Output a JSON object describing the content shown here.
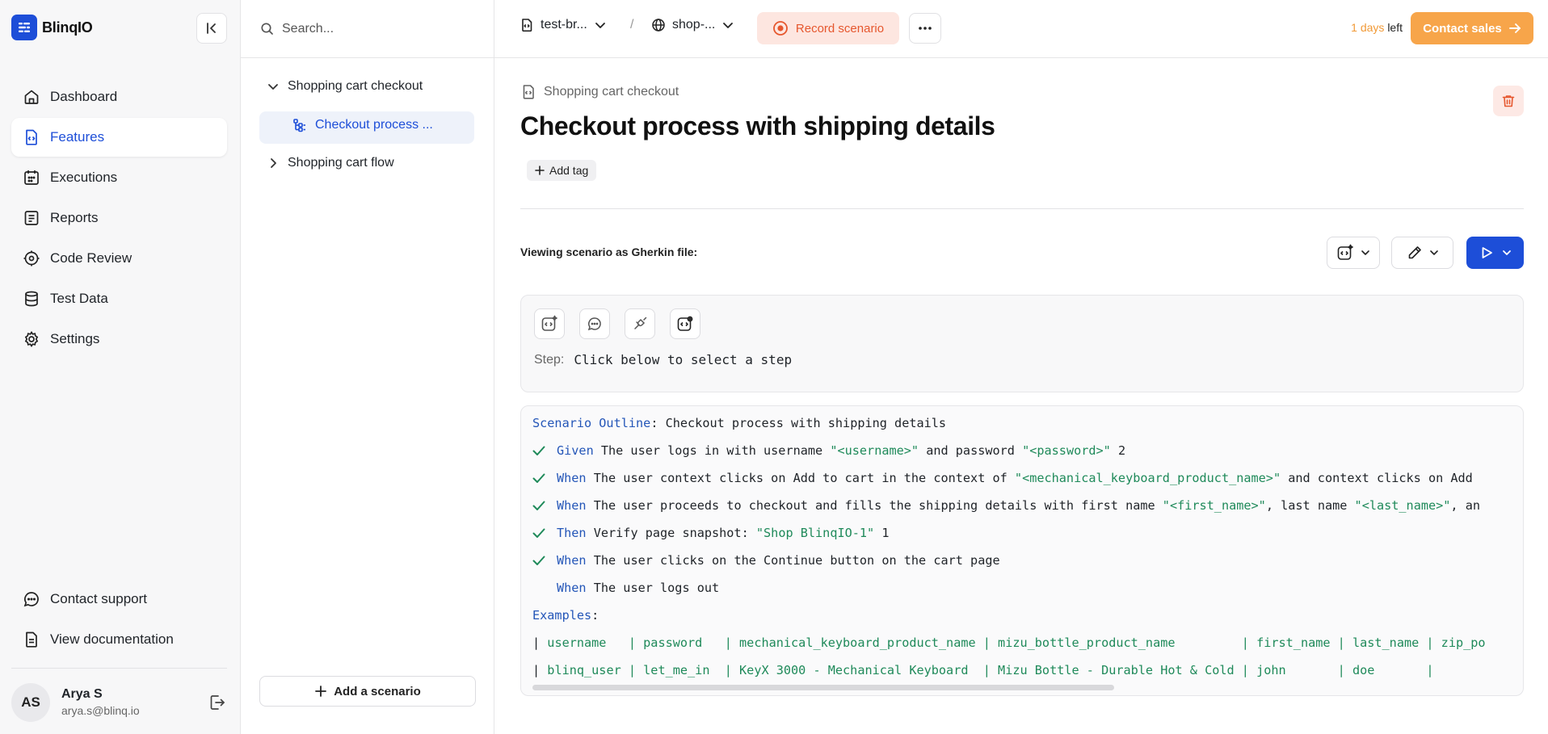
{
  "app": {
    "name": "BlinqIO"
  },
  "sidebar": {
    "collapse_label": "Collapse sidebar",
    "nav": [
      {
        "label": "Dashboard",
        "icon": "home-icon"
      },
      {
        "label": "Features",
        "icon": "feature-file-icon",
        "active": true
      },
      {
        "label": "Executions",
        "icon": "calendar-icon"
      },
      {
        "label": "Reports",
        "icon": "report-icon"
      },
      {
        "label": "Code Review",
        "icon": "code-review-icon"
      },
      {
        "label": "Test Data",
        "icon": "database-icon"
      },
      {
        "label": "Settings",
        "icon": "gear-icon"
      }
    ],
    "bottom": [
      {
        "label": "Contact support",
        "icon": "chat-icon"
      },
      {
        "label": "View documentation",
        "icon": "document-icon"
      }
    ],
    "user": {
      "initials": "AS",
      "name": "Arya S",
      "email": "arya.s@blinq.io"
    }
  },
  "tree": {
    "search_placeholder": "Search...",
    "items": [
      {
        "label": "Shopping cart checkout",
        "expanded": true
      },
      {
        "label": "Checkout process ...",
        "selected": true
      },
      {
        "label": "Shopping cart flow",
        "expanded": false
      }
    ],
    "add_scenario_label": "Add a scenario"
  },
  "topbar": {
    "project": "test-br...",
    "separator": "/",
    "environment": "shop-...",
    "record_label": "Record scenario",
    "trial_days": "1 days",
    "trial_suffix": "left",
    "contact_sales_label": "Contact sales"
  },
  "main": {
    "feature_name": "Shopping cart checkout",
    "title": "Checkout process with shipping details",
    "add_tag_label": "Add tag",
    "viewing_label": "Viewing scenario as Gherkin file:",
    "step_label": "Step:",
    "step_value": "Click below to select a step",
    "colors": {
      "accent": "#1d4ed8",
      "record": "#e6572e",
      "sales": "#f7a54a",
      "keyword": "#2456b8",
      "string": "#1f8a5a"
    }
  },
  "gherkin": {
    "outline_keyword": "Scenario Outline",
    "outline_title": ": Checkout process with shipping details",
    "steps": [
      {
        "done": true,
        "keyword": "Given",
        "parts": [
          {
            "t": " The user logs in with username "
          },
          {
            "s": "\"<username>\""
          },
          {
            "t": " and password "
          },
          {
            "s": "\"<password>\""
          },
          {
            "t": " 2"
          }
        ]
      },
      {
        "done": true,
        "keyword": "When",
        "parts": [
          {
            "t": " The user context clicks on Add to cart in the context of "
          },
          {
            "s": "\"<mechanical_keyboard_product_name>\""
          },
          {
            "t": " and context clicks on Add"
          }
        ]
      },
      {
        "done": true,
        "keyword": "When",
        "parts": [
          {
            "t": " The user proceeds to checkout and fills the shipping details with first name "
          },
          {
            "s": "\"<first_name>\""
          },
          {
            "t": ", last name "
          },
          {
            "s": "\"<last_name>\""
          },
          {
            "t": ", an"
          }
        ]
      },
      {
        "done": true,
        "keyword": "Then",
        "parts": [
          {
            "t": " Verify page snapshot: "
          },
          {
            "s": "\"Shop BlinqIO-1\""
          },
          {
            "t": " 1"
          }
        ]
      },
      {
        "done": true,
        "keyword": "When",
        "parts": [
          {
            "t": " The user clicks on the Continue button on the cart page"
          }
        ]
      },
      {
        "done": false,
        "keyword": "When",
        "parts": [
          {
            "t": " The user logs out"
          }
        ]
      }
    ],
    "examples_keyword": "Examples",
    "examples_colon": ":",
    "table_header": "username   | password   | mechanical_keyboard_product_name | mizu_bottle_product_name         | first_name | last_name | zip_po",
    "table_row": "blinq_user | let_me_in  | KeyX 3000 - Mechanical Keyboard  | Mizu Bottle - Durable Hot & Cold | john       | doe       |"
  }
}
